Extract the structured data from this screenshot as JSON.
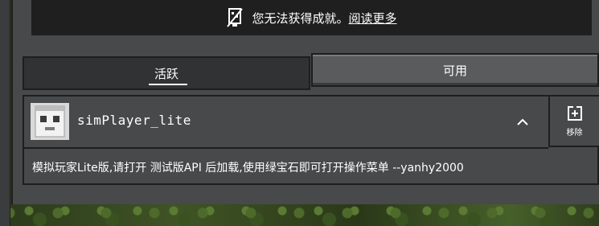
{
  "banner": {
    "icon": "no-achievements-icon",
    "message": "您无法获得成就。",
    "link_label": "阅读更多"
  },
  "tabs": [
    {
      "label": "活跃",
      "active": true
    },
    {
      "label": "可用",
      "active": false
    }
  ],
  "pack": {
    "name": "simPlayer_lite",
    "thumbnail_icon": "pack-thumbnail-icon",
    "expand_icon": "chevron-up-icon",
    "remove_label": "移除",
    "remove_icon": "remove-pack-icon",
    "description": "模拟玩家Lite版,请打开 测试版API 后加载,使用绿宝石即可打开操作菜单 --yanhy2000"
  }
}
